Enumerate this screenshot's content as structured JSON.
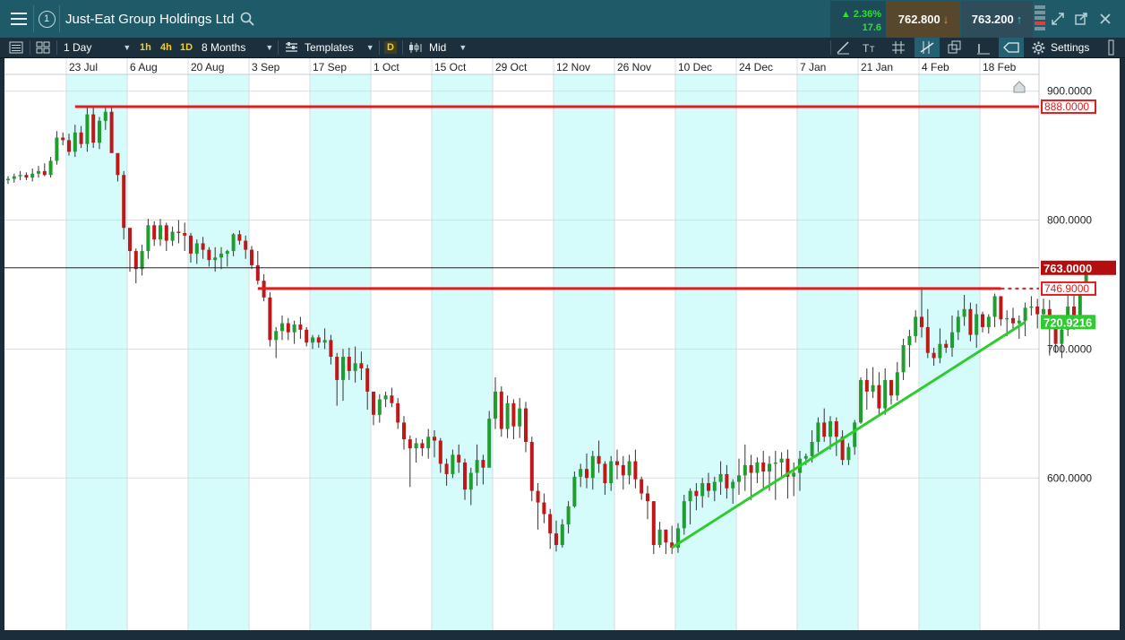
{
  "header": {
    "instrument_badge": "1",
    "instrument_name": "Just-Eat Group Holdings Ltd",
    "change_percent": "2.36%",
    "change_abs": "17.6",
    "sell_price": "762.800",
    "buy_price": "763.200"
  },
  "toolbar": {
    "interval": "1 Day",
    "quick_1h": "1h",
    "quick_4h": "4h",
    "quick_1d": "1D",
    "range": "8 Months",
    "templates": "Templates",
    "price_type_badge": "D",
    "price_type": "Mid",
    "settings": "Settings"
  },
  "colors": {
    "up_candle": "#1e9e2e",
    "down_candle": "#c01818",
    "resistance_line": "#e01e1e",
    "support_line": "#2ecc2e",
    "band": "#d6fbfb",
    "current_price_tag": "#b40e0e",
    "support_tag": "#2ecc2e"
  },
  "chart_data": {
    "type": "candlestick",
    "x_ticks": [
      "23 Jul",
      "6 Aug",
      "20 Aug",
      "3 Sep",
      "17 Sep",
      "1 Oct",
      "15 Oct",
      "29 Oct",
      "12 Nov",
      "26 Nov",
      "10 Dec",
      "24 Dec",
      "7 Jan",
      "21 Jan",
      "4 Feb",
      "18 Feb"
    ],
    "y_ticks": [
      "900.0000",
      "800.0000",
      "700.0000",
      "600.0000"
    ],
    "y_tick_values": [
      900,
      800,
      700,
      600
    ],
    "ylim": [
      482,
      913
    ],
    "grid": true,
    "current_price": {
      "value": 763.0,
      "label": "763.0000"
    },
    "levels": [
      {
        "name": "resistance-high",
        "value": 888.0,
        "label": "888.0000"
      },
      {
        "name": "resistance-mid",
        "value": 746.9,
        "label": "746.9000"
      }
    ],
    "support_trendline": {
      "from": {
        "x_index": 109,
        "value": 546
      },
      "to": {
        "x_index": 167,
        "value": 720.9216
      },
      "label": "720.9216"
    },
    "candles": [
      [
        831,
        834,
        828,
        832
      ],
      [
        832,
        836,
        829,
        834
      ],
      [
        834,
        838,
        831,
        835
      ],
      [
        835,
        837,
        831,
        833
      ],
      [
        833,
        840,
        830,
        836
      ],
      [
        836,
        842,
        833,
        838
      ],
      [
        838,
        844,
        834,
        835
      ],
      [
        835,
        849,
        833,
        846
      ],
      [
        846,
        869,
        843,
        864
      ],
      [
        864,
        868,
        858,
        862
      ],
      [
        862,
        867,
        850,
        853
      ],
      [
        853,
        874,
        849,
        868
      ],
      [
        868,
        873,
        856,
        859
      ],
      [
        859,
        889,
        853,
        882
      ],
      [
        882,
        887,
        856,
        860
      ],
      [
        860,
        880,
        855,
        877
      ],
      [
        877,
        889,
        870,
        884
      ],
      [
        884,
        889,
        855,
        852
      ],
      [
        852,
        842,
        830,
        835
      ],
      [
        835,
        838,
        785,
        794
      ],
      [
        794,
        782,
        760,
        776
      ],
      [
        776,
        778,
        751,
        762
      ],
      [
        762,
        781,
        757,
        776
      ],
      [
        776,
        801,
        770,
        796
      ],
      [
        796,
        799,
        780,
        785
      ],
      [
        785,
        801,
        780,
        796
      ],
      [
        796,
        798,
        776,
        784
      ],
      [
        784,
        795,
        780,
        791
      ],
      [
        791,
        800,
        782,
        790
      ],
      [
        790,
        798,
        776,
        788
      ],
      [
        788,
        790,
        767,
        774
      ],
      [
        774,
        785,
        766,
        782
      ],
      [
        782,
        787,
        770,
        777
      ],
      [
        777,
        779,
        764,
        769
      ],
      [
        769,
        779,
        760,
        771
      ],
      [
        771,
        779,
        762,
        774
      ],
      [
        774,
        777,
        764,
        776
      ],
      [
        776,
        790,
        772,
        789
      ],
      [
        789,
        792,
        781,
        784
      ],
      [
        784,
        788,
        770,
        777
      ],
      [
        777,
        780,
        762,
        765
      ],
      [
        765,
        776,
        750,
        753
      ],
      [
        753,
        758,
        737,
        740
      ],
      [
        740,
        744,
        702,
        707
      ],
      [
        707,
        717,
        693,
        714
      ],
      [
        714,
        726,
        707,
        720
      ],
      [
        720,
        724,
        707,
        713
      ],
      [
        713,
        722,
        704,
        719
      ],
      [
        719,
        725,
        708,
        715
      ],
      [
        715,
        717,
        702,
        705
      ],
      [
        705,
        711,
        700,
        709
      ],
      [
        709,
        711,
        701,
        705
      ],
      [
        705,
        716,
        700,
        707
      ],
      [
        707,
        711,
        688,
        694
      ],
      [
        694,
        697,
        656,
        676
      ],
      [
        676,
        700,
        660,
        694
      ],
      [
        694,
        701,
        676,
        683
      ],
      [
        683,
        702,
        674,
        689
      ],
      [
        689,
        698,
        676,
        685
      ],
      [
        685,
        688,
        653,
        667
      ],
      [
        667,
        664,
        641,
        649
      ],
      [
        649,
        665,
        643,
        661
      ],
      [
        661,
        667,
        655,
        664
      ],
      [
        664,
        670,
        655,
        658
      ],
      [
        658,
        662,
        638,
        643
      ],
      [
        643,
        648,
        622,
        630
      ],
      [
        630,
        633,
        593,
        623
      ],
      [
        623,
        631,
        612,
        627
      ],
      [
        627,
        630,
        617,
        623
      ],
      [
        623,
        638,
        615,
        632
      ],
      [
        632,
        637,
        616,
        629
      ],
      [
        629,
        631,
        604,
        611
      ],
      [
        611,
        615,
        594,
        603
      ],
      [
        603,
        622,
        600,
        618
      ],
      [
        618,
        626,
        604,
        612
      ],
      [
        612,
        615,
        583,
        591
      ],
      [
        591,
        608,
        579,
        604
      ],
      [
        604,
        626,
        594,
        614
      ],
      [
        614,
        618,
        595,
        608
      ],
      [
        608,
        652,
        608,
        646
      ],
      [
        646,
        678,
        638,
        667
      ],
      [
        667,
        671,
        632,
        638
      ],
      [
        638,
        664,
        631,
        658
      ],
      [
        658,
        661,
        630,
        640
      ],
      [
        640,
        662,
        631,
        654
      ],
      [
        654,
        659,
        620,
        628
      ],
      [
        628,
        632,
        582,
        590
      ],
      [
        590,
        596,
        560,
        581
      ],
      [
        581,
        588,
        565,
        572
      ],
      [
        572,
        576,
        545,
        557
      ],
      [
        557,
        567,
        543,
        548
      ],
      [
        548,
        568,
        546,
        564
      ],
      [
        564,
        582,
        557,
        578
      ],
      [
        578,
        605,
        577,
        601
      ],
      [
        601,
        611,
        593,
        607
      ],
      [
        607,
        619,
        592,
        600
      ],
      [
        600,
        621,
        591,
        617
      ],
      [
        617,
        629,
        604,
        611
      ],
      [
        611,
        613,
        587,
        596
      ],
      [
        596,
        617,
        590,
        613
      ],
      [
        613,
        622,
        599,
        610
      ],
      [
        610,
        617,
        591,
        602
      ],
      [
        602,
        618,
        595,
        613
      ],
      [
        613,
        622,
        592,
        599
      ],
      [
        599,
        601,
        583,
        588
      ],
      [
        588,
        594,
        568,
        582
      ],
      [
        582,
        582,
        541,
        548
      ],
      [
        548,
        566,
        546,
        560
      ],
      [
        560,
        558,
        541,
        550
      ],
      [
        550,
        563,
        541,
        546
      ],
      [
        546,
        565,
        542,
        561
      ],
      [
        561,
        587,
        556,
        582
      ],
      [
        582,
        592,
        564,
        590
      ],
      [
        590,
        596,
        575,
        586
      ],
      [
        586,
        600,
        577,
        596
      ],
      [
        596,
        604,
        585,
        590
      ],
      [
        590,
        601,
        582,
        597
      ],
      [
        597,
        613,
        587,
        603
      ],
      [
        603,
        610,
        584,
        592
      ],
      [
        592,
        599,
        580,
        597
      ],
      [
        597,
        615,
        587,
        602
      ],
      [
        602,
        626,
        590,
        610
      ],
      [
        610,
        618,
        583,
        604
      ],
      [
        604,
        616,
        596,
        612
      ],
      [
        612,
        621,
        591,
        605
      ],
      [
        605,
        617,
        590,
        611
      ],
      [
        611,
        621,
        583,
        612
      ],
      [
        612,
        620,
        600,
        615
      ],
      [
        615,
        622,
        584,
        601
      ],
      [
        601,
        612,
        586,
        604
      ],
      [
        604,
        621,
        590,
        615
      ],
      [
        615,
        619,
        610,
        617
      ],
      [
        617,
        637,
        612,
        628
      ],
      [
        628,
        647,
        620,
        643
      ],
      [
        643,
        654,
        628,
        632
      ],
      [
        632,
        648,
        622,
        644
      ],
      [
        644,
        647,
        617,
        632
      ],
      [
        632,
        637,
        610,
        614
      ],
      [
        614,
        627,
        610,
        624
      ],
      [
        624,
        645,
        618,
        643
      ],
      [
        643,
        678,
        642,
        676
      ],
      [
        676,
        685,
        653,
        667
      ],
      [
        667,
        686,
        662,
        672
      ],
      [
        672,
        682,
        649,
        654
      ],
      [
        654,
        685,
        649,
        676
      ],
      [
        676,
        674,
        657,
        664
      ],
      [
        664,
        690,
        660,
        682
      ],
      [
        682,
        708,
        676,
        703
      ],
      [
        703,
        715,
        686,
        710
      ],
      [
        710,
        730,
        705,
        725
      ],
      [
        725,
        748,
        709,
        717
      ],
      [
        717,
        731,
        693,
        697
      ],
      [
        697,
        701,
        687,
        693
      ],
      [
        693,
        716,
        689,
        704
      ],
      [
        704,
        707,
        697,
        701
      ],
      [
        701,
        726,
        694,
        713
      ],
      [
        713,
        730,
        707,
        725
      ],
      [
        725,
        742,
        718,
        731
      ],
      [
        731,
        736,
        706,
        711
      ],
      [
        711,
        735,
        701,
        727
      ],
      [
        727,
        729,
        713,
        717
      ],
      [
        717,
        727,
        712,
        725
      ],
      [
        725,
        743,
        717,
        741
      ],
      [
        741,
        740,
        718,
        723
      ],
      [
        723,
        730,
        710,
        724
      ],
      [
        724,
        732,
        714,
        720
      ],
      [
        720,
        726,
        708,
        722
      ],
      [
        722,
        736,
        710,
        732
      ],
      [
        732,
        741,
        726,
        733
      ],
      [
        733,
        739,
        716,
        727
      ],
      [
        727,
        739,
        718,
        731
      ],
      [
        731,
        738,
        695,
        722
      ],
      [
        722,
        722,
        697,
        704
      ],
      [
        704,
        716,
        693,
        715
      ],
      [
        715,
        748,
        710,
        733
      ],
      [
        733,
        743,
        715,
        724
      ],
      [
        724,
        745,
        719,
        745
      ],
      [
        745,
        765,
        746,
        763
      ]
    ]
  }
}
